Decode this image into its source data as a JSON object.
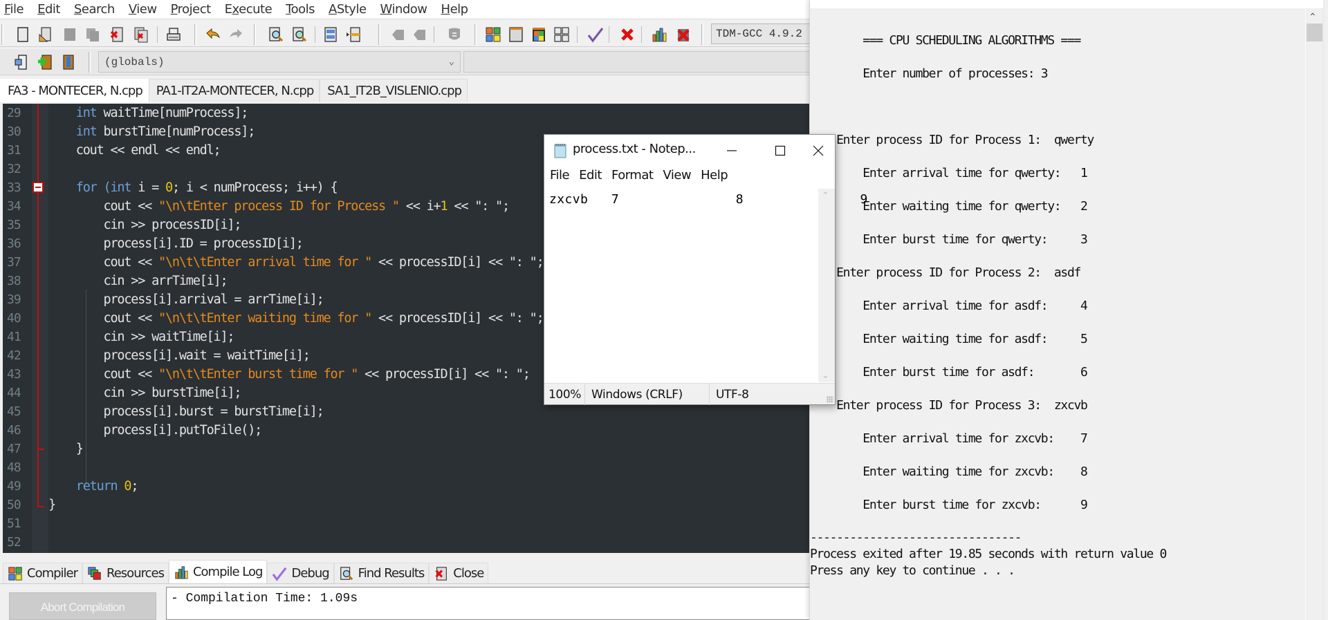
{
  "ide": {
    "menu": [
      "File",
      "Edit",
      "Search",
      "View",
      "Project",
      "Execute",
      "Tools",
      "AStyle",
      "Window",
      "Help"
    ],
    "menu_access_keys": [
      "F",
      "E",
      "S",
      "V",
      "P",
      "x",
      "T",
      "A",
      "W",
      "H"
    ],
    "compiler_selector": "TDM-GCC 4.9.2",
    "scope_selector": "(globals)",
    "tabs": [
      {
        "label": "FA3 - MONTECER, N.cpp",
        "active": true
      },
      {
        "label": "PA1-IT2A-MONTECER, N.cpp",
        "active": false
      },
      {
        "label": "SA1_IT2B_VISLENIO.cpp",
        "active": false
      }
    ],
    "toolbar_icons": [
      "new-file-icon",
      "open-file-icon",
      "save-icon",
      "save-all-icon",
      "close-file-icon",
      "close-all-icon",
      "print-icon",
      "undo-icon",
      "redo-icon",
      "find-icon",
      "replace-icon",
      "indent-icon",
      "unindent-icon",
      "goto-prev-icon",
      "goto-next-icon",
      "bookmark-icon",
      "compile-icon",
      "run-icon",
      "compile-run-icon",
      "rebuild-icon",
      "syntax-check-icon",
      "stop-icon",
      "profile-icon",
      "delete-profile-icon"
    ],
    "toolbar2_icons": [
      "new-class-icon",
      "add-to-project-icon",
      "remove-from-project-icon"
    ],
    "code_lines": [
      {
        "n": "29",
        "tokens": [
          [
            "    ",
            ""
          ],
          [
            "int",
            "kw"
          ],
          [
            " waitTime[numProcess];",
            ""
          ]
        ]
      },
      {
        "n": "30",
        "tokens": [
          [
            "    ",
            ""
          ],
          [
            "int",
            "kw"
          ],
          [
            " burstTime[numProcess];",
            ""
          ]
        ]
      },
      {
        "n": "31",
        "tokens": [
          [
            "    cout << endl << endl;",
            ""
          ]
        ]
      },
      {
        "n": "32",
        "tokens": []
      },
      {
        "n": "33",
        "tokens": [
          [
            "    ",
            ""
          ],
          [
            "for",
            "kw"
          ],
          [
            " ",
            ""
          ],
          [
            "(int",
            "kw"
          ],
          [
            " i = ",
            ""
          ],
          [
            "0",
            "num"
          ],
          [
            "; i < numProcess; i++) {",
            ""
          ]
        ]
      },
      {
        "n": "34",
        "tokens": [
          [
            "        cout << ",
            ""
          ],
          [
            "\"\\n\\tEnter process ID for Process \"",
            "str"
          ],
          [
            " << i+",
            ""
          ],
          [
            "1",
            "num"
          ],
          [
            " << \": \";",
            ""
          ]
        ]
      },
      {
        "n": "35",
        "tokens": [
          [
            "        cin >> processID[i];",
            ""
          ]
        ]
      },
      {
        "n": "36",
        "tokens": [
          [
            "        process[i].ID = processID[i];",
            ""
          ]
        ]
      },
      {
        "n": "37",
        "tokens": [
          [
            "        cout << ",
            ""
          ],
          [
            "\"\\n\\t\\tEnter arrival time for \"",
            "str"
          ],
          [
            " << processID[i] << \": \";",
            ""
          ]
        ]
      },
      {
        "n": "38",
        "tokens": [
          [
            "        cin >> arrTime[i];",
            ""
          ]
        ]
      },
      {
        "n": "39",
        "tokens": [
          [
            "        process[i].arrival = arrTime[i];",
            ""
          ]
        ]
      },
      {
        "n": "40",
        "tokens": [
          [
            "        cout << ",
            ""
          ],
          [
            "\"\\n\\t\\tEnter waiting time for \"",
            "str"
          ],
          [
            " << processID[i] << \": \";",
            ""
          ]
        ]
      },
      {
        "n": "41",
        "tokens": [
          [
            "        cin >> waitTime[i];",
            ""
          ]
        ]
      },
      {
        "n": "42",
        "tokens": [
          [
            "        process[i].wait = waitTime[i];",
            ""
          ]
        ]
      },
      {
        "n": "43",
        "tokens": [
          [
            "        cout << ",
            ""
          ],
          [
            "\"\\n\\t\\tEnter burst time for \"",
            "str"
          ],
          [
            " << processID[i] << \": \";",
            ""
          ]
        ]
      },
      {
        "n": "44",
        "tokens": [
          [
            "        cin >> burstTime[i];",
            ""
          ]
        ]
      },
      {
        "n": "45",
        "tokens": [
          [
            "        process[i].burst = burstTime[i];",
            ""
          ]
        ]
      },
      {
        "n": "46",
        "tokens": [
          [
            "        process[i].putToFile();",
            ""
          ]
        ]
      },
      {
        "n": "47",
        "tokens": [
          [
            "    }",
            ""
          ]
        ]
      },
      {
        "n": "48",
        "tokens": []
      },
      {
        "n": "49",
        "tokens": [
          [
            "    ",
            ""
          ],
          [
            "return",
            "kw"
          ],
          [
            " ",
            ""
          ],
          [
            "0",
            "num"
          ],
          [
            ";",
            ""
          ]
        ]
      },
      {
        "n": "50",
        "tokens": [
          [
            "}",
            ""
          ]
        ]
      },
      {
        "n": "51",
        "tokens": []
      },
      {
        "n": "52",
        "tokens": []
      }
    ],
    "bottom_tabs": [
      {
        "label": "Compiler",
        "icon": "compiler-grid-icon",
        "active": false
      },
      {
        "label": "Resources",
        "icon": "resources-icon",
        "active": false
      },
      {
        "label": "Compile Log",
        "icon": "bar-chart-icon",
        "active": true
      },
      {
        "label": "Debug",
        "icon": "check-icon",
        "active": false
      },
      {
        "label": "Find Results",
        "icon": "find-icon",
        "active": false
      },
      {
        "label": "Close",
        "icon": "close-icon",
        "active": false
      }
    ],
    "abort_button": "Abort Compilation",
    "compile_log": "- Compilation Time: 1.09s"
  },
  "notepad": {
    "title": "process.txt - Notep...",
    "menu": [
      "File",
      "Edit",
      "Format",
      "View",
      "Help"
    ],
    "content": "zxcvb\t7\t\t8\t\t9",
    "status": {
      "zoom": "100%",
      "line_ending": "Windows (CRLF)",
      "encoding": "UTF-8"
    }
  },
  "console": {
    "lines": [
      {
        "text": "\t=== CPU SCHEDULING ALGORITHMS ===",
        "row": 1
      },
      {
        "text": "\tEnter number of processes: 3",
        "row": 3
      },
      {
        "text": "    Enter process ID for Process 1:  qwerty",
        "row": 7
      },
      {
        "text": "\tEnter arrival time for qwerty:   1",
        "row": 9
      },
      {
        "text": "\tEnter waiting time for qwerty:   2",
        "row": 11
      },
      {
        "text": "\tEnter burst time for qwerty:     3",
        "row": 13
      },
      {
        "text": "    Enter process ID for Process 2:  asdf",
        "row": 15
      },
      {
        "text": "\tEnter arrival time for asdf:     4",
        "row": 17
      },
      {
        "text": "\tEnter waiting time for asdf:     5",
        "row": 19
      },
      {
        "text": "\tEnter burst time for asdf:       6",
        "row": 21
      },
      {
        "text": "    Enter process ID for Process 3:  zxcvb",
        "row": 23
      },
      {
        "text": "\tEnter arrival time for zxcvb:    7",
        "row": 25
      },
      {
        "text": "\tEnter waiting time for zxcvb:    8",
        "row": 27
      },
      {
        "text": "\tEnter burst time for zxcvb:      9",
        "row": 29
      },
      {
        "text": "--------------------------------",
        "row": 32
      },
      {
        "text": "Process exited after 19.85 seconds with return value 0",
        "row": 33
      },
      {
        "text": "Press any key to continue . . .",
        "row": 34
      }
    ]
  },
  "colors": {
    "editor_bg": "#2b3034",
    "keyword": "#6c9fd6",
    "string": "#e68a1e",
    "number": "#e6c21a",
    "fold_marker": "#c01010"
  }
}
